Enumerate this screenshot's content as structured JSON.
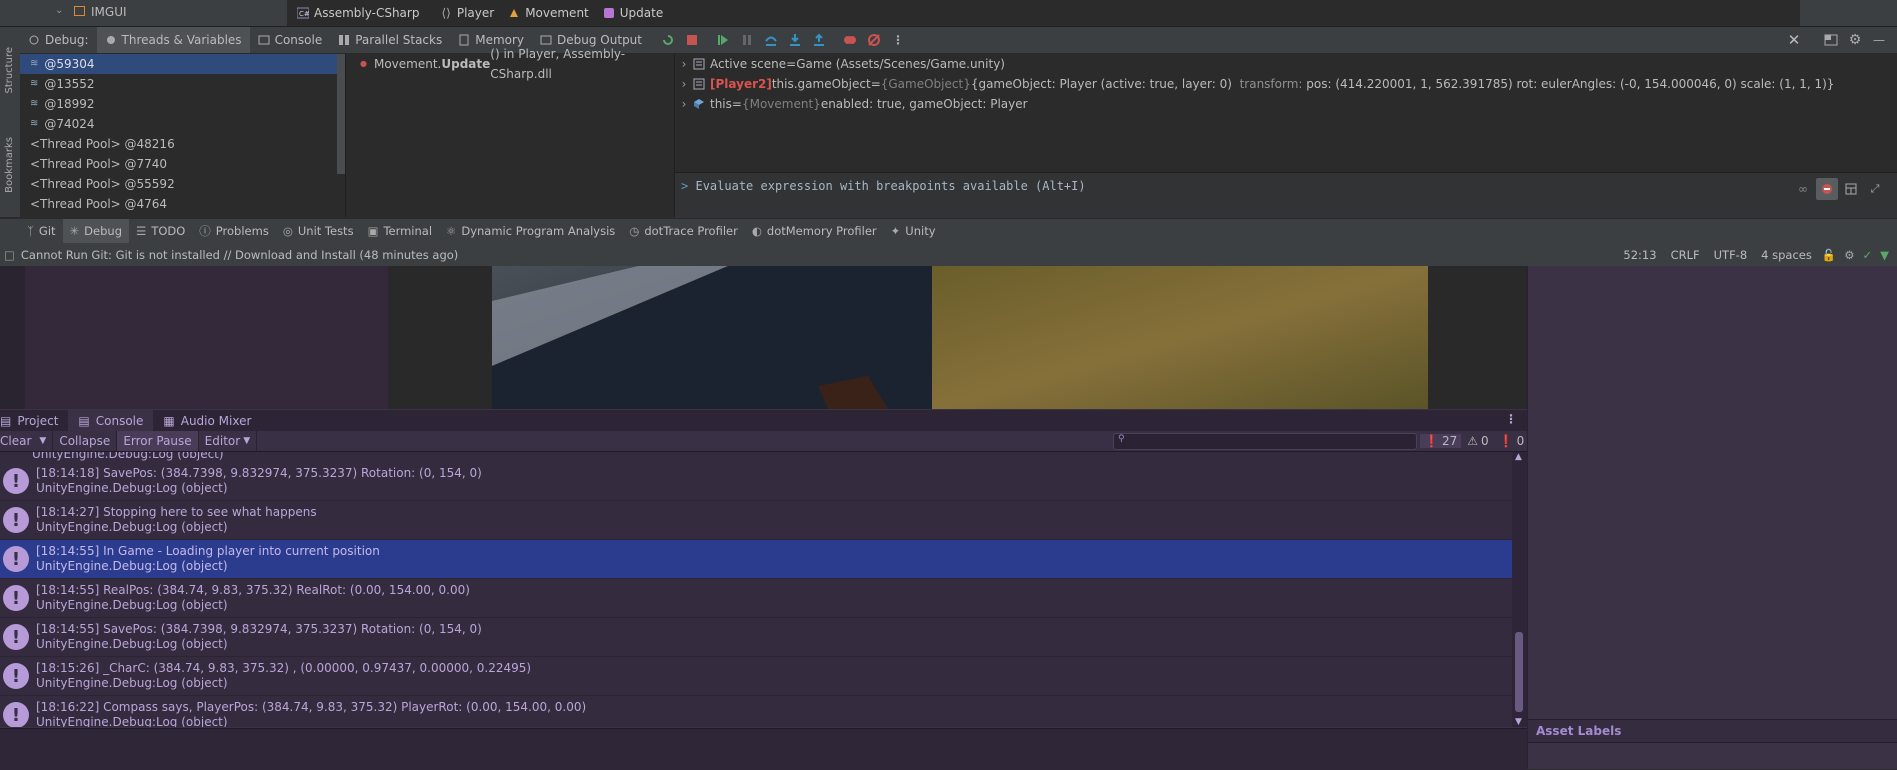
{
  "top": {
    "imgui_label": "IMGUI",
    "breadcrumbs": [
      "Assembly-CSharp",
      "Player",
      "Movement",
      "Update"
    ]
  },
  "debug": {
    "label": "Debug:",
    "tabs": [
      "Threads & Variables",
      "Console",
      "Parallel Stacks",
      "Memory",
      "Debug Output"
    ]
  },
  "side": {
    "structure": "Structure",
    "bookmarks": "Bookmarks"
  },
  "threads": [
    "@59304",
    "@13552",
    "@18992",
    "@74024",
    "<Thread Pool> @48216",
    "<Thread Pool> @7740",
    "<Thread Pool> @55592",
    "<Thread Pool> @4764"
  ],
  "frame": {
    "method": "Movement.",
    "method_bold": "Update",
    "rest": "() in Player, Assembly-CSharp.dll"
  },
  "variables": [
    {
      "name": "Active scene",
      "eq": " = ",
      "value": "Game (Assets/Scenes/Game.unity)"
    },
    {
      "tag": "[Player2]",
      "name": " this.gameObject",
      "eq": " = ",
      "type": "{GameObject} ",
      "value": "{gameObject: Player (active: true, layer: 0)",
      "extra": "  transform: ",
      "value2": "pos: (414.220001, 1, 562.391785) rot: eulerAngles: (-0, 154.000046, 0) scale: (1, 1, 1)}"
    },
    {
      "name": "this",
      "eq": " = ",
      "type": "{Movement} ",
      "value": "enabled: true, gameObject: Player"
    }
  ],
  "eval_placeholder": "Evaluate expression with breakpoints available (Alt+I)",
  "toolwindows": [
    "Git",
    "Debug",
    "TODO",
    "Problems",
    "Unit Tests",
    "Terminal",
    "Dynamic Program Analysis",
    "dotTrace Profiler",
    "dotMemory Profiler",
    "Unity"
  ],
  "status": {
    "message": "Cannot Run Git: Git is not installed // Download and Install (48 minutes ago)",
    "position": "52:13",
    "line_sep": "CRLF",
    "encoding": "UTF-8",
    "indent": "4 spaces"
  },
  "console": {
    "tabs": [
      "Project",
      "Console",
      "Audio Mixer"
    ],
    "tools": [
      "Clear",
      "Collapse",
      "Error Pause",
      "Editor"
    ],
    "counts": {
      "info": "27",
      "warn": "0",
      "error": "0"
    },
    "cut_line": "UnityEngine.Debug:Log (object)",
    "logs": [
      {
        "line1": "[18:14:18] SavePos: (384.7398, 9.832974, 375.3237)  Rotation: (0, 154, 0)",
        "line2": "UnityEngine.Debug:Log (object)"
      },
      {
        "line1": "[18:14:27] Stopping here to see what happens",
        "line2": "UnityEngine.Debug:Log (object)"
      },
      {
        "line1": "[18:14:55] In Game - Loading player into current position",
        "line2": "UnityEngine.Debug:Log (object)"
      },
      {
        "line1": "[18:14:55] RealPos: (384.74, 9.83, 375.32) RealRot: (0.00, 154.00, 0.00)",
        "line2": "UnityEngine.Debug:Log (object)"
      },
      {
        "line1": "[18:14:55] SavePos: (384.7398, 9.832974, 375.3237)  Rotation: (0, 154, 0)",
        "line2": "UnityEngine.Debug:Log (object)"
      },
      {
        "line1": "[18:15:26] _CharC: (384.74, 9.83, 375.32) , (0.00000, 0.97437, 0.00000, 0.22495)",
        "line2": "UnityEngine.Debug:Log (object)"
      },
      {
        "line1": "[18:16:22] Compass says, PlayerPos: (384.74, 9.83, 375.32) PlayerRot: (0.00, 154.00, 0.00)",
        "line2": "UnityEngine.Debug:Log (object)"
      }
    ]
  },
  "inspector": {
    "asset_labels": "Asset Labels"
  },
  "colors": {
    "selection_blue": "#2f4b7b",
    "console_selection": "#2b3c8f",
    "log_text": "#b9a6d8",
    "stop_red": "#c75450",
    "resume_green": "#59a869"
  }
}
